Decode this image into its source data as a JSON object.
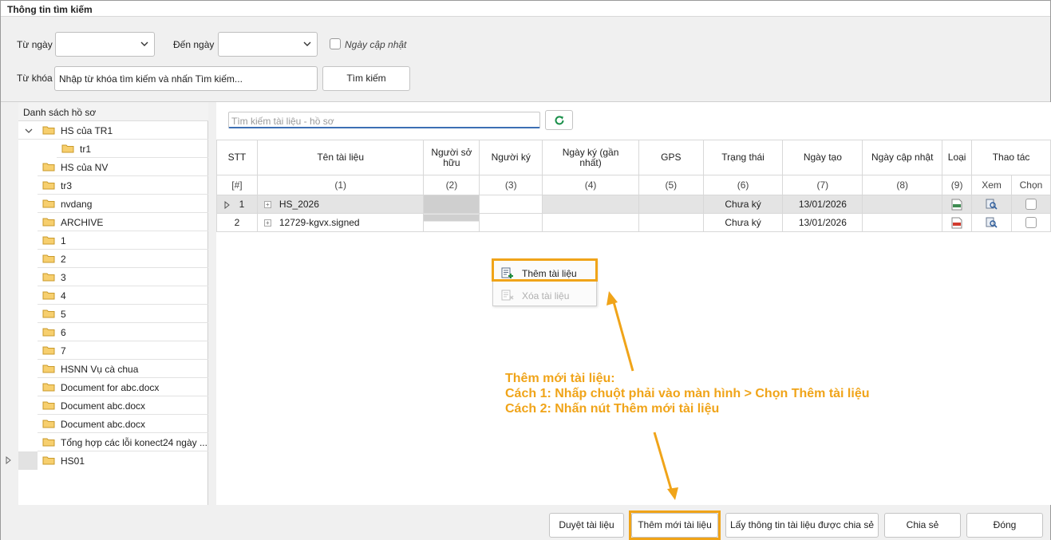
{
  "window": {
    "title": "Thông tin tìm kiếm"
  },
  "filters": {
    "from_label": "Từ ngày",
    "to_label": "Đến ngày",
    "updated_label": "Ngày cập nhật",
    "keyword_label": "Từ khóa",
    "keyword_value": "Nhập từ khóa tìm kiếm và nhấn Tìm kiếm...",
    "search_button": "Tìm kiếm"
  },
  "tree": {
    "header": "Danh sách hồ sơ",
    "items": [
      "HS của TR1",
      "tr1",
      "HS của NV",
      "tr3",
      "nvdang",
      "ARCHIVE",
      "1",
      "2",
      "3",
      "4",
      "5",
      "6",
      "7",
      "HSNN Vụ cà chua",
      "Document for abc.docx",
      "Document abc.docx",
      "Document abc.docx",
      "Tổng hợp các lỗi konect24 ngày ...",
      "HS01"
    ]
  },
  "doc_search": {
    "placeholder": "Tìm kiếm tài liệu - hồ sơ",
    "refresh_icon": "refresh-icon"
  },
  "grid": {
    "headers": {
      "stt": "STT",
      "name": "Tên tài liệu",
      "owner": "Người sở hữu",
      "signer": "Người ký",
      "signed_date": "Ngày ký (gần nhất)",
      "gps": "GPS",
      "status": "Trạng thái",
      "created": "Ngày tạo",
      "updated": "Ngày cập nhật",
      "type": "Loại",
      "actions": "Thao tác",
      "view": "Xem",
      "select": "Chọn"
    },
    "index_row": [
      "[#]",
      "(1)",
      "(2)",
      "(3)",
      "(4)",
      "(5)",
      "(6)",
      "(7)",
      "(8)",
      "(9)"
    ],
    "rows": [
      {
        "stt": "1",
        "name": "HS_2026",
        "status": "Chưa ký",
        "created": "13/01/2026",
        "type_icon": "docx-file-icon"
      },
      {
        "stt": "2",
        "name": "12729-kgvx.signed",
        "status": "Chưa ký",
        "created": "13/01/2026",
        "type_icon": "pdf-file-icon"
      }
    ]
  },
  "context_menu": {
    "add": "Thêm tài liệu",
    "delete": "Xóa tài liệu"
  },
  "annotation": {
    "line1": "Thêm mới tài liệu:",
    "line2": "Cách 1: Nhấp chuột phải vào màn hình > Chọn Thêm tài liệu",
    "line3": "Cách 2: Nhấn nút Thêm mới tài liệu"
  },
  "footer": {
    "browse": "Duyệt tài liệu",
    "add_new": "Thêm mới tài liệu",
    "shared": "Lấy thông tin tài liệu được chia sẻ",
    "share": "Chia sẻ",
    "close": "Đóng"
  },
  "colors": {
    "highlight": "#f0a419",
    "refresh": "#1a8f4a"
  }
}
